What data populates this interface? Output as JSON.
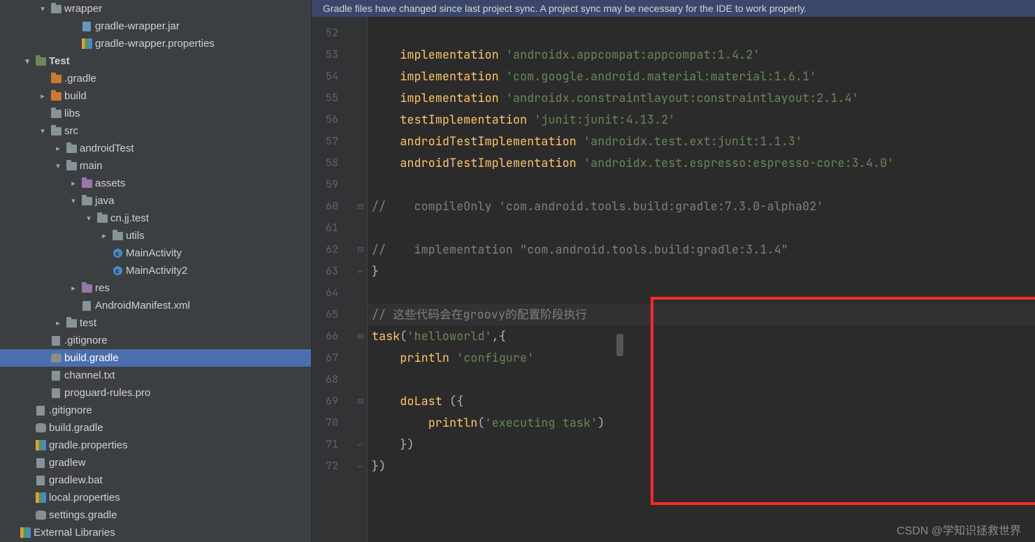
{
  "notice": "Gradle files have changed since last project sync. A project sync may be necessary for the IDE to work properly.",
  "watermark": "CSDN @学知识拯救世界",
  "tree": [
    {
      "indent": 1,
      "caret": "down",
      "icon": "folder",
      "label": "wrapper"
    },
    {
      "indent": 3,
      "caret": "blank",
      "icon": "file-java",
      "label": "gradle-wrapper.jar"
    },
    {
      "indent": 3,
      "caret": "blank",
      "icon": "libs",
      "label": "gradle-wrapper.properties"
    },
    {
      "indent": 0,
      "caret": "down",
      "icon": "folder-test",
      "label": "Test",
      "bold": true
    },
    {
      "indent": 1,
      "caret": "blank",
      "icon": "folder-mod",
      "label": ".gradle"
    },
    {
      "indent": 1,
      "caret": "right",
      "icon": "folder-mod",
      "label": "build"
    },
    {
      "indent": 1,
      "caret": "blank",
      "icon": "folder",
      "label": "libs"
    },
    {
      "indent": 1,
      "caret": "down",
      "icon": "folder",
      "label": "src"
    },
    {
      "indent": 2,
      "caret": "right",
      "icon": "folder",
      "label": "androidTest"
    },
    {
      "indent": 2,
      "caret": "down",
      "icon": "folder",
      "label": "main"
    },
    {
      "indent": 3,
      "caret": "right",
      "icon": "folder-res",
      "label": "assets"
    },
    {
      "indent": 3,
      "caret": "down",
      "icon": "folder",
      "label": "java"
    },
    {
      "indent": 4,
      "caret": "down",
      "icon": "folder",
      "label": "cn.jj.test"
    },
    {
      "indent": 5,
      "caret": "right",
      "icon": "folder",
      "label": "utils"
    },
    {
      "indent": 5,
      "caret": "blank",
      "icon": "file-c",
      "label": "MainActivity"
    },
    {
      "indent": 5,
      "caret": "blank",
      "icon": "file-c",
      "label": "MainActivity2"
    },
    {
      "indent": 3,
      "caret": "right",
      "icon": "folder-res",
      "label": "res"
    },
    {
      "indent": 3,
      "caret": "blank",
      "icon": "file",
      "label": "AndroidManifest.xml"
    },
    {
      "indent": 2,
      "caret": "right",
      "icon": "folder",
      "label": "test"
    },
    {
      "indent": 1,
      "caret": "blank",
      "icon": "git",
      "label": ".gitignore"
    },
    {
      "indent": 1,
      "caret": "blank",
      "icon": "elephant",
      "label": "build.gradle",
      "selected": true
    },
    {
      "indent": 1,
      "caret": "blank",
      "icon": "file",
      "label": "channel.txt"
    },
    {
      "indent": 1,
      "caret": "blank",
      "icon": "file",
      "label": "proguard-rules.pro"
    },
    {
      "indent": 0,
      "caret": "blank",
      "icon": "git",
      "label": ".gitignore"
    },
    {
      "indent": 0,
      "caret": "blank",
      "icon": "elephant",
      "label": "build.gradle"
    },
    {
      "indent": 0,
      "caret": "blank",
      "icon": "libs",
      "label": "gradle.properties"
    },
    {
      "indent": 0,
      "caret": "blank",
      "icon": "file",
      "label": "gradlew"
    },
    {
      "indent": 0,
      "caret": "blank",
      "icon": "file",
      "label": "gradlew.bat"
    },
    {
      "indent": 0,
      "caret": "blank",
      "icon": "libs",
      "label": "local.properties"
    },
    {
      "indent": 0,
      "caret": "blank",
      "icon": "elephant",
      "label": "settings.gradle"
    },
    {
      "indent": -1,
      "caret": "blank",
      "icon": "libs",
      "label": "External Libraries"
    }
  ],
  "lineStart": 52,
  "lines": [
    {
      "tokens": []
    },
    {
      "tokens": [
        {
          "t": "    ",
          "c": ""
        },
        {
          "t": "implementation ",
          "c": "mth"
        },
        {
          "t": "'androidx.appcompat:appcompat:1.4.2'",
          "c": "str"
        }
      ]
    },
    {
      "tokens": [
        {
          "t": "    ",
          "c": ""
        },
        {
          "t": "implementation ",
          "c": "mth"
        },
        {
          "t": "'com.google.android.material:material:1.6.1'",
          "c": "str"
        }
      ]
    },
    {
      "tokens": [
        {
          "t": "    ",
          "c": ""
        },
        {
          "t": "implementation ",
          "c": "mth"
        },
        {
          "t": "'androidx.constraintlayout:constraintlayout:2.1.4'",
          "c": "str"
        }
      ]
    },
    {
      "tokens": [
        {
          "t": "    ",
          "c": ""
        },
        {
          "t": "testImplementation ",
          "c": "mth"
        },
        {
          "t": "'junit:junit:4.13.2'",
          "c": "str"
        }
      ]
    },
    {
      "tokens": [
        {
          "t": "    ",
          "c": ""
        },
        {
          "t": "androidTestImplementation ",
          "c": "mth"
        },
        {
          "t": "'androidx.test.ext:junit:1.1.3'",
          "c": "str"
        }
      ]
    },
    {
      "tokens": [
        {
          "t": "    ",
          "c": ""
        },
        {
          "t": "androidTestImplementation ",
          "c": "mth"
        },
        {
          "t": "'androidx.test.espresso:espresso-core:3.4.0'",
          "c": "str"
        }
      ]
    },
    {
      "tokens": []
    },
    {
      "tokens": [
        {
          "t": "//    compileOnly 'com.android.tools.build:gradle:7.3.0-alpha02'",
          "c": "cm"
        }
      ],
      "fold": "["
    },
    {
      "tokens": []
    },
    {
      "tokens": [
        {
          "t": "//    implementation \"com.android.tools.build:gradle:3.1.4\"",
          "c": "cm"
        }
      ],
      "fold": "["
    },
    {
      "tokens": [
        {
          "t": "}",
          "c": ""
        }
      ],
      "fold": "]"
    },
    {
      "tokens": []
    },
    {
      "tokens": [
        {
          "t": "// 这些代码会在groovy的配置阶段执行",
          "c": "cm"
        }
      ],
      "current": true
    },
    {
      "tokens": [
        {
          "t": "task",
          "c": "mth"
        },
        {
          "t": "(",
          "c": ""
        },
        {
          "t": "'helloworld'",
          "c": "str"
        },
        {
          "t": ",{",
          "c": ""
        }
      ],
      "fold": "["
    },
    {
      "tokens": [
        {
          "t": "    ",
          "c": ""
        },
        {
          "t": "println ",
          "c": "mth"
        },
        {
          "t": "'configure'",
          "c": "str"
        }
      ]
    },
    {
      "tokens": []
    },
    {
      "tokens": [
        {
          "t": "    ",
          "c": ""
        },
        {
          "t": "doLast ",
          "c": "mth"
        },
        {
          "t": "({",
          "c": ""
        }
      ],
      "fold": "["
    },
    {
      "tokens": [
        {
          "t": "        ",
          "c": ""
        },
        {
          "t": "println",
          "c": "mth"
        },
        {
          "t": "(",
          "c": ""
        },
        {
          "t": "'executing task'",
          "c": "str"
        },
        {
          "t": ")",
          "c": ""
        }
      ]
    },
    {
      "tokens": [
        {
          "t": "    })",
          "c": ""
        }
      ],
      "fold": "]"
    },
    {
      "tokens": [
        {
          "t": "})",
          "c": ""
        }
      ],
      "fold": "]"
    }
  ]
}
